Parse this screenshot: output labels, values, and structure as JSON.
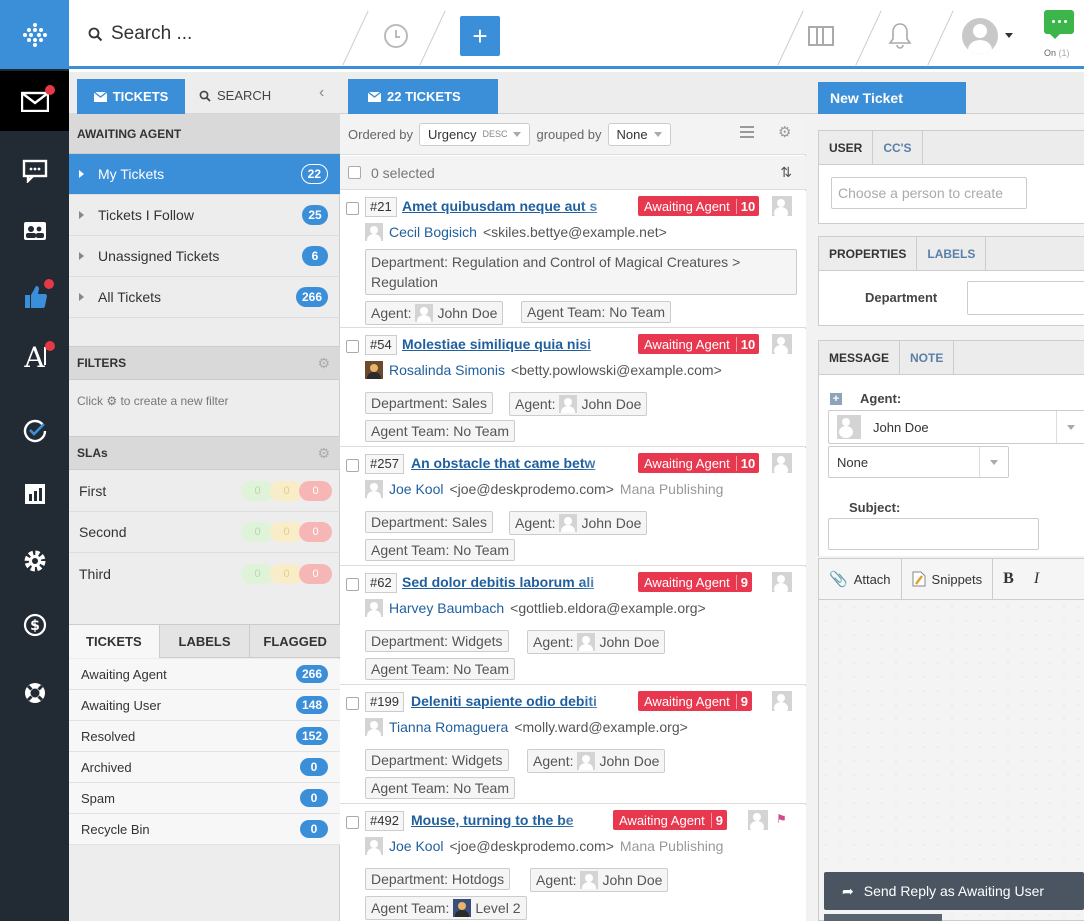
{
  "topbar": {
    "search_placeholder": "Search ...",
    "chat_status": "On",
    "chat_count": "(1)"
  },
  "nav": {
    "items": [
      "tickets-icon",
      "chat-icon",
      "people-icon",
      "feedback-icon",
      "publish-icon",
      "tasks-icon",
      "reports-icon",
      "admin-icon",
      "billing-icon",
      "help-icon"
    ]
  },
  "panel1": {
    "tab_tickets": "TICKETS",
    "tab_search": "SEARCH",
    "awaiting_header": "AWAITING AGENT",
    "folders": [
      {
        "label": "My Tickets",
        "count": "22"
      },
      {
        "label": "Tickets I Follow",
        "count": "25"
      },
      {
        "label": "Unassigned Tickets",
        "count": "6"
      },
      {
        "label": "All Tickets",
        "count": "266"
      }
    ],
    "filters_header": "FILTERS",
    "filters_empty_pre": "Click",
    "filters_empty_post": "to create a new filter",
    "slas_header": "SLAs",
    "slas": [
      {
        "label": "First",
        "g": "0",
        "y": "0",
        "r": "0"
      },
      {
        "label": "Second",
        "g": "0",
        "y": "0",
        "r": "0"
      },
      {
        "label": "Third",
        "g": "0",
        "y": "0",
        "r": "0"
      }
    ],
    "bottom_tabs": [
      "TICKETS",
      "LABELS",
      "FLAGGED"
    ],
    "statuses": [
      {
        "label": "Awaiting Agent",
        "count": "266"
      },
      {
        "label": "Awaiting User",
        "count": "148"
      },
      {
        "label": "Resolved",
        "count": "152"
      },
      {
        "label": "Archived",
        "count": "0"
      },
      {
        "label": "Spam",
        "count": "0"
      },
      {
        "label": "Recycle Bin",
        "count": "0"
      }
    ]
  },
  "panel2": {
    "tab_label": "22 TICKETS",
    "ordered_by": "Ordered by",
    "order_value": "Urgency",
    "order_dir": "DESC",
    "grouped_by": "grouped by",
    "group_value": "None",
    "selected_text": "0 selected",
    "tickets": [
      {
        "id": "#21",
        "subject": "Amet quibusdam neque aut s",
        "status": "Awaiting Agent",
        "urgency": "10",
        "person": "Cecil Bogisich",
        "email": "<skiles.bettye@example.net>",
        "org": "",
        "department": "Department: Regulation and Control of Magical Creatures > Regulation",
        "agent_label": "Agent:",
        "agent": "John Doe",
        "team": "Agent Team: No Team",
        "team_label": "",
        "team_name": ""
      },
      {
        "id": "#54",
        "subject": "Molestiae similique quia nisi",
        "status": "Awaiting Agent",
        "urgency": "10",
        "person": "Rosalinda Simonis",
        "email": "<betty.powlowski@example.com>",
        "org": "",
        "department": "Department: Sales",
        "agent_label": "Agent:",
        "agent": "John Doe",
        "team": "Agent Team: No Team",
        "team_label": "",
        "team_name": ""
      },
      {
        "id": "#257",
        "subject": "An obstacle that came betw",
        "status": "Awaiting Agent",
        "urgency": "10",
        "person": "Joe Kool",
        "email": "<joe@deskprodemo.com>",
        "org": "Mana Publishing",
        "department": "Department: Sales",
        "agent_label": "Agent:",
        "agent": "John Doe",
        "team": "Agent Team: No Team",
        "team_label": "",
        "team_name": ""
      },
      {
        "id": "#62",
        "subject": "Sed dolor debitis laborum ali",
        "status": "Awaiting Agent",
        "urgency": "9",
        "person": "Harvey Baumbach",
        "email": "<gottlieb.eldora@example.org>",
        "org": "",
        "department": "Department: Widgets",
        "agent_label": "Agent:",
        "agent": "John Doe",
        "team": "Agent Team: No Team",
        "team_label": "",
        "team_name": ""
      },
      {
        "id": "#199",
        "subject": "Deleniti sapiente odio debiti",
        "status": "Awaiting Agent",
        "urgency": "9",
        "person": "Tianna Romaguera",
        "email": "<molly.ward@example.org>",
        "org": "",
        "department": "Department: Widgets",
        "agent_label": "Agent:",
        "agent": "John Doe",
        "team": "Agent Team: No Team",
        "team_label": "",
        "team_name": ""
      },
      {
        "id": "#492",
        "subject": "Mouse, turning to the be",
        "status": "Awaiting Agent",
        "urgency": "9",
        "person": "Joe Kool",
        "email": "<joe@deskprodemo.com>",
        "org": "Mana Publishing",
        "department": "Department: Hotdogs",
        "agent_label": "Agent:",
        "agent": "John Doe",
        "team": "",
        "team_label": "Agent Team:",
        "team_name": "Level 2"
      }
    ]
  },
  "panel3": {
    "tab_label": "New Ticket",
    "user_tabs": [
      "USER",
      "CC'S"
    ],
    "person_placeholder": "Choose a person to create",
    "prop_tabs": [
      "PROPERTIES",
      "LABELS"
    ],
    "department_label": "Department",
    "msg_tabs": [
      "MESSAGE",
      "NOTE"
    ],
    "agent_label": "Agent:",
    "agent_value": "John Doe",
    "team_value": "None",
    "subject_label": "Subject:",
    "attach_label": "Attach",
    "snippets_label": "Snippets",
    "bold_label": "B",
    "italic_label": "I",
    "send_label": "Send Reply as Awaiting User"
  },
  "colors": {
    "accent": "#3b8fd9",
    "nav": "#222a33",
    "badge": "#e8384f",
    "chat": "#3cb54a"
  }
}
